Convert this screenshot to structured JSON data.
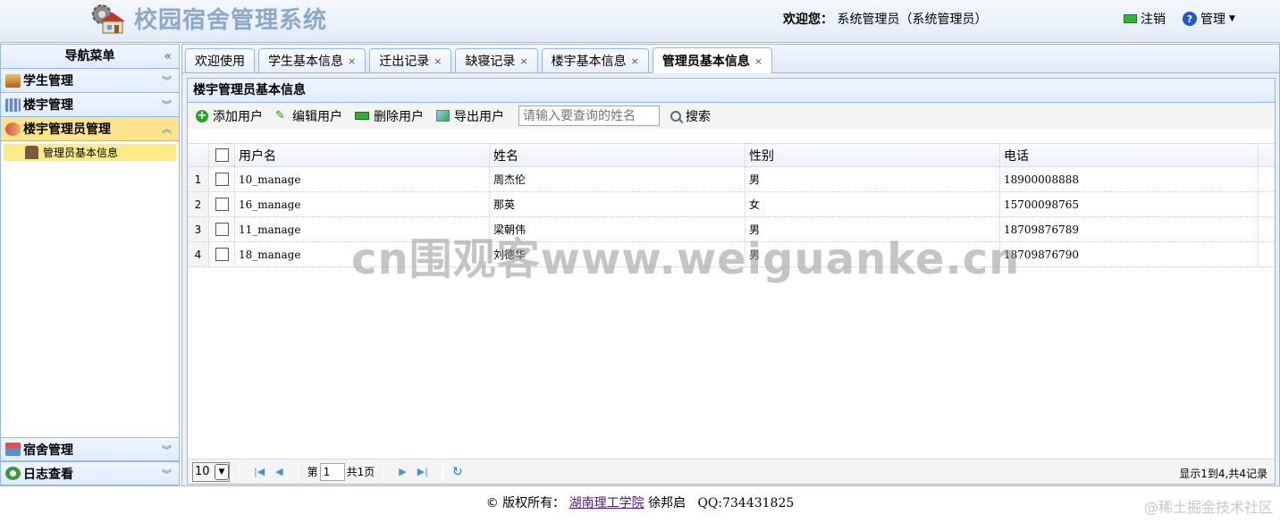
{
  "header": {
    "title": "校园宿舍管理系统",
    "welcome_label": "欢迎您：",
    "welcome_user": "系统管理员（系统管理员）",
    "logout": "注销",
    "admin": "管理"
  },
  "nav": {
    "title": "导航菜单",
    "collapse": "«",
    "items": [
      {
        "label": "学生管理"
      },
      {
        "label": "楼宇管理"
      },
      {
        "label": "楼宇管理员管理"
      }
    ],
    "subitem": "管理员基本信息",
    "bottom_items": [
      {
        "label": "宿舍管理"
      },
      {
        "label": "日志查看"
      }
    ]
  },
  "tabs": [
    {
      "label": "欢迎使用",
      "closable": false
    },
    {
      "label": "学生基本信息",
      "closable": true
    },
    {
      "label": "迁出记录",
      "closable": true
    },
    {
      "label": "缺寝记录",
      "closable": true
    },
    {
      "label": "楼宇基本信息",
      "closable": true
    },
    {
      "label": "管理员基本信息",
      "closable": true,
      "active": true
    }
  ],
  "panel": {
    "title": "楼宇管理员基本信息",
    "toolbar": {
      "add": "添加用户",
      "edit": "编辑用户",
      "delete": "删除用户",
      "export": "导出用户",
      "search_placeholder": "请输入要查询的姓名",
      "search": "搜索"
    },
    "columns": [
      "用户名",
      "姓名",
      "性别",
      "电话"
    ],
    "rows": [
      {
        "num": "1",
        "username": "10_manage",
        "name": "周杰伦",
        "sex": "男",
        "phone": "18900008888"
      },
      {
        "num": "2",
        "username": "16_manage",
        "name": "那英",
        "sex": "女",
        "phone": "15700098765"
      },
      {
        "num": "3",
        "username": "11_manage",
        "name": "梁朝伟",
        "sex": "男",
        "phone": "18709876789"
      },
      {
        "num": "4",
        "username": "18_manage",
        "name": "刘德华",
        "sex": "男",
        "phone": "18709876790"
      }
    ],
    "pager": {
      "page_size": "10",
      "page_prefix": "第",
      "page_value": "1",
      "page_suffix": "共1页",
      "info": "显示1到4,共4记录"
    }
  },
  "footer": {
    "copyright": "© 版权所有：",
    "school": "湖南理工学院",
    "author": "徐邦启",
    "qq": "QQ:734431825"
  },
  "watermark": "cn围观客www.weiguanke.cn",
  "corner_watermark": "@稀土掘金技术社区"
}
